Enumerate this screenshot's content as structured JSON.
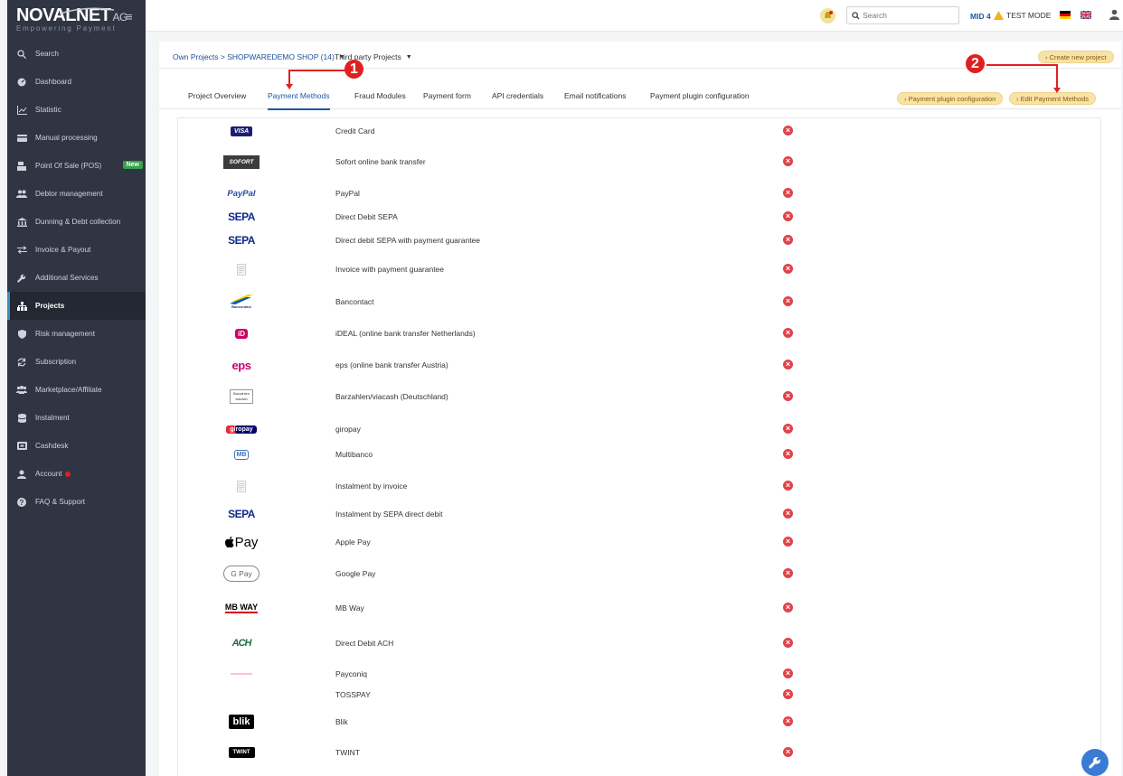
{
  "brand": {
    "name": "NOVALNET",
    "suffix": "AG",
    "tagline": "Empowering Payment"
  },
  "sidebar": {
    "items": [
      {
        "label": "Search",
        "icon": "search-icon"
      },
      {
        "label": "Dashboard",
        "icon": "dashboard-icon"
      },
      {
        "label": "Statistic",
        "icon": "chart-icon"
      },
      {
        "label": "Manual processing",
        "icon": "card-icon"
      },
      {
        "label": "Point Of Sale (POS)",
        "icon": "pos-icon",
        "badge": "New"
      },
      {
        "label": "Debtor management",
        "icon": "users-icon"
      },
      {
        "label": "Dunning & Debt collection",
        "icon": "bank-icon"
      },
      {
        "label": "Invoice & Payout",
        "icon": "exchange-icon"
      },
      {
        "label": "Additional Services",
        "icon": "wrench-icon"
      },
      {
        "label": "Projects",
        "icon": "sitemap-icon",
        "active": true
      },
      {
        "label": "Risk management",
        "icon": "shield-icon"
      },
      {
        "label": "Subscription",
        "icon": "refresh-icon"
      },
      {
        "label": "Marketplace/Affiliate",
        "icon": "group-icon"
      },
      {
        "label": "Instalment",
        "icon": "database-icon"
      },
      {
        "label": "Cashdesk",
        "icon": "cashdesk-icon"
      },
      {
        "label": "Account",
        "icon": "user-icon",
        "dot": true
      },
      {
        "label": "FAQ & Support",
        "icon": "help-icon"
      }
    ]
  },
  "topbar": {
    "search_placeholder": "Search",
    "mid": "MID 4",
    "test_mode": "TEST MODE"
  },
  "breadcrumb": {
    "own_projects": "Own Projects > SHOPWAREDEMO SHOP (14)",
    "third_party": "Third party Projects"
  },
  "actions": {
    "create_project": "› Create new project",
    "plugin_config": "› Payment plugin configuration",
    "edit_methods": "› Edit Payment Methods"
  },
  "tabs": [
    {
      "label": "Project Overview"
    },
    {
      "label": "Payment Methods",
      "active": true
    },
    {
      "label": "Fraud Modules"
    },
    {
      "label": "Payment form"
    },
    {
      "label": "API credentials"
    },
    {
      "label": "Email notifications"
    },
    {
      "label": "Payment plugin configuration"
    }
  ],
  "payment_methods": [
    {
      "name": "Credit Card",
      "logo": "VISA"
    },
    {
      "name": "Sofort online bank transfer",
      "logo": "SOFORT"
    },
    {
      "name": "PayPal",
      "logo": "PayPal"
    },
    {
      "name": "Direct Debit SEPA",
      "logo": "SEPA"
    },
    {
      "name": "Direct debit SEPA with payment guarantee",
      "logo": "SEPA"
    },
    {
      "name": "Invoice with payment guarantee",
      "logo": ""
    },
    {
      "name": "Bancontact",
      "logo": "Bancontact"
    },
    {
      "name": "iDEAL (online bank transfer Netherlands)",
      "logo": "iD"
    },
    {
      "name": "eps (online bank transfer Austria)",
      "logo": "eps"
    },
    {
      "name": "Barzahlen/viacash (Deutschland)",
      "logo": "Barzahlen viacash"
    },
    {
      "name": "giropay",
      "logo": "giropay"
    },
    {
      "name": "Multibanco",
      "logo": "MB"
    },
    {
      "name": "Instalment by invoice",
      "logo": ""
    },
    {
      "name": "Instalment by SEPA direct debit",
      "logo": "SEPA"
    },
    {
      "name": "Apple Pay",
      "logo": "Pay"
    },
    {
      "name": "Google Pay",
      "logo": "G Pay"
    },
    {
      "name": "MB Way",
      "logo": "MB WAY"
    },
    {
      "name": "Direct Debit ACH",
      "logo": "ACH"
    },
    {
      "name": "Payconiq",
      "logo": ""
    },
    {
      "name": "TOSSPAY",
      "logo": ""
    },
    {
      "name": "Blik",
      "logo": "blik"
    },
    {
      "name": "TWINT",
      "logo": "TWINT"
    }
  ],
  "status_symbol": "×",
  "annotations": {
    "one": "1",
    "two": "2"
  },
  "colors": {
    "accent": "#1b58a5",
    "sidebar": "#2f3542",
    "pill": "#f7e3a6",
    "error": "#e0434b",
    "annotation": "#e02020"
  }
}
